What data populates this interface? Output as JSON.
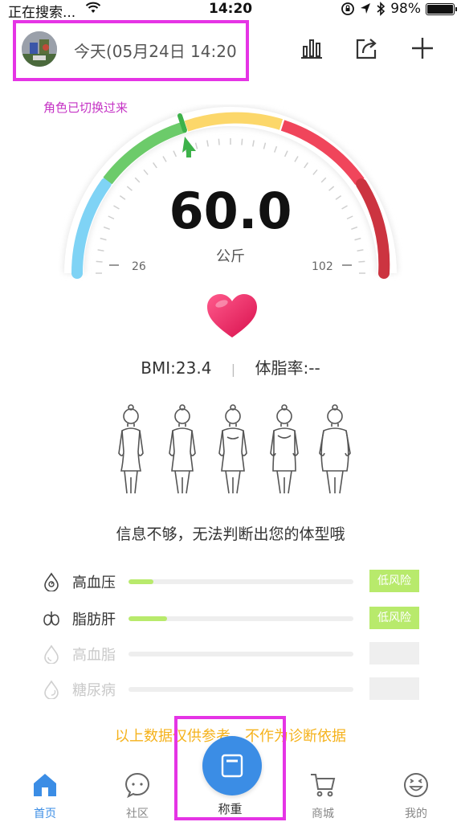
{
  "status_bar": {
    "carrier": "正在搜索...",
    "time": "14:20",
    "battery": "98%"
  },
  "header": {
    "date_title": "今天(05月24日 14:20"
  },
  "role_note": "角色已切换过来",
  "gauge": {
    "weight": "60.0",
    "unit": "公斤",
    "range_min": "26",
    "range_max": "102"
  },
  "metrics": {
    "bmi": "BMI:23.4",
    "separator": "|",
    "body_fat": "体脂率:--"
  },
  "body_type_message": "信息不够，无法判断出您的体型哦",
  "risks": [
    {
      "label": "高血压",
      "badge": "低风险",
      "level": 0.11
    },
    {
      "label": "脂肪肝",
      "badge": "低风险",
      "level": 0.17
    },
    {
      "label": "高血脂",
      "badge": "",
      "level": 0
    },
    {
      "label": "糖尿病",
      "badge": "",
      "level": 0
    }
  ],
  "disclaimer": "以上数据仅供参考，不作为诊断依据",
  "tabs": {
    "home": "首页",
    "community": "社区",
    "weigh": "称重",
    "mall": "商城",
    "mine": "我的"
  },
  "colors": {
    "accent": "#3b8de5",
    "highlight_box": "#e534e5",
    "risk_low": "#b8ea6c",
    "disclaimer": "#f5b21c"
  }
}
